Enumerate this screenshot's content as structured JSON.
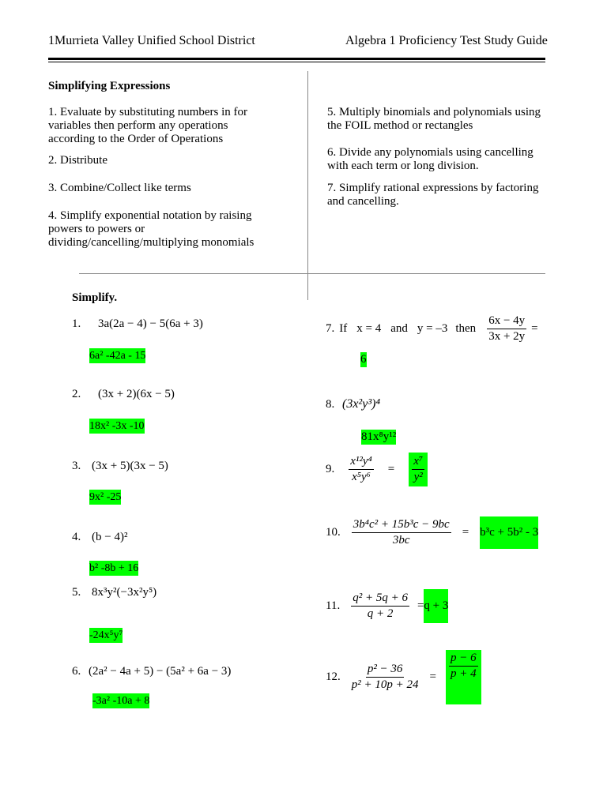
{
  "header": {
    "left": "1Murrieta Valley Unified School District",
    "right": "Algebra 1 Proficiency Test Study Guide"
  },
  "section_title": "Simplifying Expressions",
  "steps": [
    {
      "line1": "1. Evaluate by substituting numbers in for",
      "line2": "variables then perform any operations",
      "line3": "according to the Order of Operations"
    },
    {
      "line1": "2.  Distribute"
    },
    {
      "line1": "3.  Combine/Collect like terms"
    },
    {
      "line1": "4.  Simplify exponential notation by raising",
      "line2": "powers to powers or",
      "line3": "dividing/cancelling/multiplying monomials"
    },
    {
      "line1": "5.  Multiply binomials and polynomials using",
      "line2": "the FOIL method or rectangles"
    },
    {
      "line1": "6.  Divide any polynomials using cancelling",
      "line2": "with each term or long division."
    },
    {
      "line1": "7.  Simplify rational expressions by factoring",
      "line2": "and cancelling."
    }
  ],
  "simplify_title": "Simplify.",
  "problems": [
    {
      "num": "1.",
      "expr": "3a(2a − 4) − 5(6a + 3)",
      "answer": "6a² -42a - 15"
    },
    {
      "num": "2.",
      "expr": "(3x + 2)(6x − 5)",
      "answer": "18x² -3x -10"
    },
    {
      "num": "3.",
      "expr": "(3x + 5)(3x − 5)",
      "answer": "9x² -25"
    },
    {
      "num": "4.",
      "expr": "(b − 4)²",
      "answer": "b² -8b + 16"
    },
    {
      "num": "5.",
      "expr": "8x³y²(−3x²y⁵)",
      "answer": "-24x⁵y⁷"
    },
    {
      "num": "6.",
      "expr": "(2a² − 4a + 5) − (5a² + 6a − 3)",
      "answer": "-3a² -10a + 8"
    },
    {
      "num": "7.",
      "prefix": "If",
      "cond1": "x = 4",
      "and": "and",
      "cond2": "y = –3",
      "then": "then",
      "numerator": "6x − 4y",
      "denominator": "3x + 2y",
      "eq": "=",
      "answer": "6"
    },
    {
      "num": "8.",
      "expr": "(3x²y³)⁴",
      "answer": "81x⁸y¹²"
    },
    {
      "num": "9.",
      "numerator": "x¹²y⁴",
      "denominator": "x⁵y⁶",
      "eq": "=",
      "answer_num": "x⁷",
      "answer_den": "y²"
    },
    {
      "num": "10.",
      "numerator": "3b⁴c² + 15b³c − 9bc",
      "denominator": "3bc",
      "eq": "=",
      "answer": "b³c + 5b² - 3"
    },
    {
      "num": "11.",
      "numerator": "q² + 5q + 6",
      "denominator": "q + 2",
      "eq": "=",
      "answer": "q + 3"
    },
    {
      "num": "12.",
      "numerator": "p² − 36",
      "denominator": "p² + 10p + 24",
      "eq": "=",
      "answer_num": "p − 6",
      "answer_den": "p + 4"
    }
  ],
  "colors": {
    "highlight": "#00ff00"
  }
}
